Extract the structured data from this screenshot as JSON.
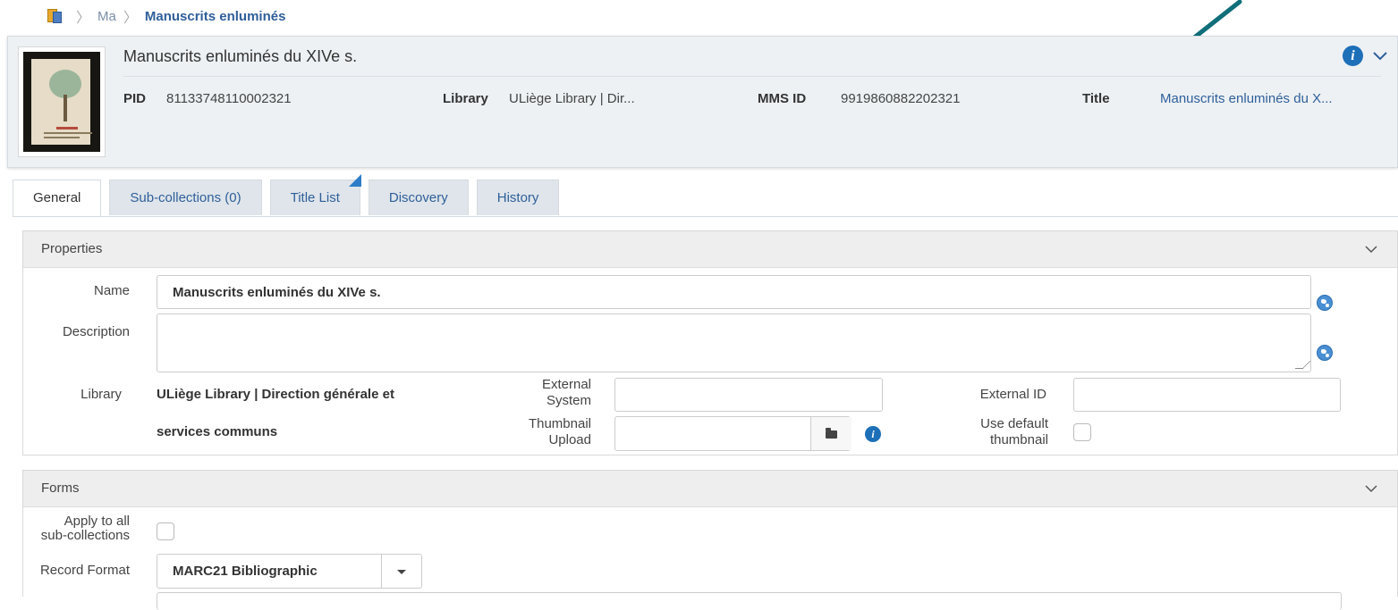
{
  "breadcrumb": {
    "items": [
      "Ma"
    ],
    "current": "Manuscrits enluminés"
  },
  "header": {
    "title": "Manuscrits enluminés du XIVe s.",
    "pid_label": "PID",
    "pid_value": "81133748110002321",
    "library_label": "Library",
    "library_value": "ULiège Library | Dir...",
    "mms_label": "MMS ID",
    "mms_value": "9919860882202321",
    "title_label": "Title",
    "title_value": "Manuscrits enluminés du X..."
  },
  "tabs": [
    {
      "label": "General",
      "active": true
    },
    {
      "label": "Sub-collections (0)",
      "active": false
    },
    {
      "label": "Title List",
      "active": false
    },
    {
      "label": "Discovery",
      "active": false
    },
    {
      "label": "History",
      "active": false
    }
  ],
  "properties": {
    "section_title": "Properties",
    "name_label": "Name",
    "name_value": "Manuscrits enluminés du XIVe s.",
    "description_label": "Description",
    "description_value": "",
    "library_label": "Library",
    "library_value_line1": "ULiège Library | Direction générale et",
    "library_value_line2": "services communs",
    "external_system_label_1": "External",
    "external_system_label_2": "System",
    "external_system_value": "",
    "external_id_label": "External ID",
    "external_id_value": "",
    "thumbnail_upload_label_1": "Thumbnail",
    "thumbnail_upload_label_2": "Upload",
    "thumbnail_upload_value": "",
    "use_default_thumbnail_label_1": "Use default",
    "use_default_thumbnail_label_2": "thumbnail",
    "use_default_thumbnail_checked": false
  },
  "forms": {
    "section_title": "Forms",
    "apply_label_1": "Apply to all",
    "apply_label_2": "sub-collections",
    "apply_checked": false,
    "record_format_label": "Record Format",
    "record_format_value": "MARC21 Bibliographic"
  },
  "colors": {
    "accent": "#2f5f9a",
    "info": "#1d6fb8",
    "annotation_arrow": "#0f6e7a"
  }
}
